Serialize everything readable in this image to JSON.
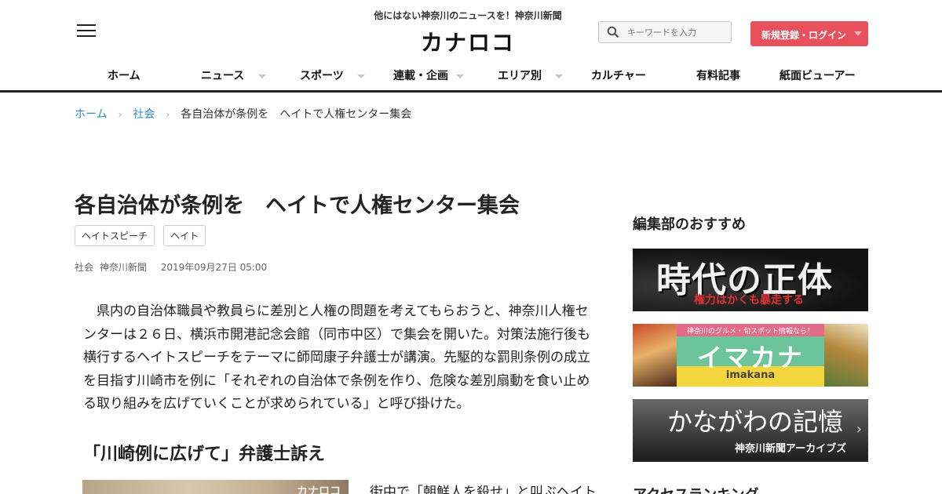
{
  "header": {
    "tagline": "他にはない神奈川のニュースを！神奈川新聞",
    "logo": "カナロコ",
    "search_placeholder": "キーワードを入力",
    "login_label": "新規登録・ログイン"
  },
  "nav": {
    "items": [
      {
        "label": "ホーム"
      },
      {
        "label": "ニュース"
      },
      {
        "label": "スポーツ"
      },
      {
        "label": "連載・企画"
      },
      {
        "label": "エリア別"
      },
      {
        "label": "カルチャー"
      },
      {
        "label": "有料記事"
      },
      {
        "label": "紙面ビューアー"
      }
    ]
  },
  "breadcrumb": {
    "home": "ホーム",
    "sep": "›",
    "category": "社会",
    "current": "各自治体が条例を　ヘイトで人権センター集会"
  },
  "article": {
    "title": "各自治体が条例を　ヘイトで人権センター集会",
    "tags": [
      "ヘイトスピーチ",
      "ヘイト"
    ],
    "category": "社会",
    "source": "神奈川新聞",
    "date": "2019年09月27日 05:00",
    "body": "　県内の自治体職員や教員らに差別と人権の問題を考えてもらおうと、神奈川人権センターは２６日、横浜市開港記念会館（同市中区）で集会を開いた。対策法施行後も横行するヘイトスピーチをテーマに師岡康子弁護士が講演。先駆的な罰則条例の成立を目指す川崎市を例に「それぞれの自治体で条例を作り、危険な差別扇動を食い止める取り組みを広げていくことが求められている」と呼び掛けた。",
    "subheading": "「川崎例に広げて」弁護士訴え",
    "photo_mark": "カナロコ",
    "body_2": "街中で「朝鮮人を殺せ」と叫ぶヘイト"
  },
  "sidebar": {
    "heading": "編集部のおすすめ",
    "banner1": {
      "title": "時代の正体",
      "subtitle": "権力はかくも暴走する"
    },
    "banner2": {
      "strip": "神奈川のグルメ・旬スポット情報なら！",
      "title": "イマカナ",
      "small": "imakana"
    },
    "banner3": {
      "title": "かながわの記憶",
      "subtitle": "神奈川新聞アーカイブズ",
      "arrow": "›"
    },
    "heading_2": "アクセスランキング"
  },
  "colors": {
    "accent": "#e8505b",
    "link": "#2a8fcf"
  }
}
